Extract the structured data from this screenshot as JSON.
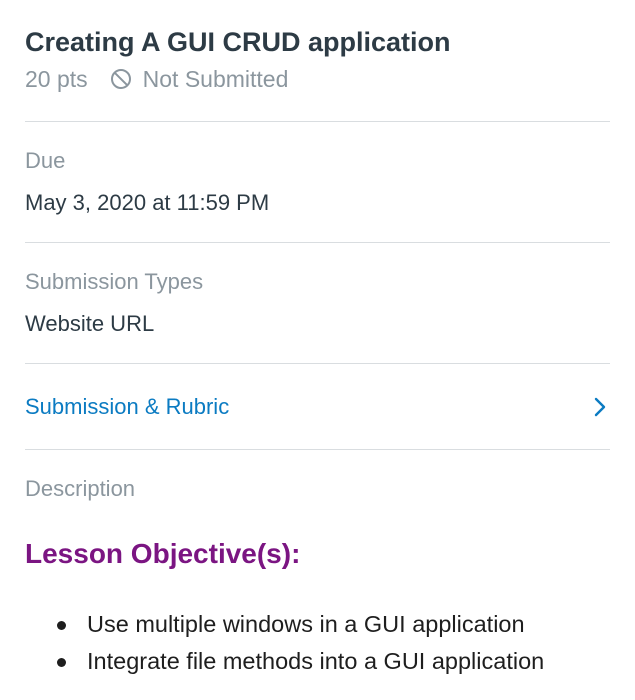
{
  "assignment": {
    "title": "Creating A GUI CRUD application",
    "points": "20 pts",
    "submission_status": "Not Submitted",
    "status_icon": "prohibited-icon"
  },
  "due": {
    "label": "Due",
    "value": "May 3, 2020 at 11:59 PM"
  },
  "submission_types": {
    "label": "Submission Types",
    "value": "Website URL"
  },
  "submission_rubric": {
    "label": "Submission & Rubric",
    "icon": "chevron-right-icon"
  },
  "description": {
    "label": "Description",
    "heading": "Lesson Objective(s):",
    "objectives": [
      "Use multiple windows in a GUI application",
      "Integrate file methods into a GUI application"
    ]
  },
  "colors": {
    "text": "#2d3b45",
    "muted": "#8b969e",
    "link": "#0b7bc2",
    "heading": "#7b1582",
    "divider": "#d9dde0"
  }
}
